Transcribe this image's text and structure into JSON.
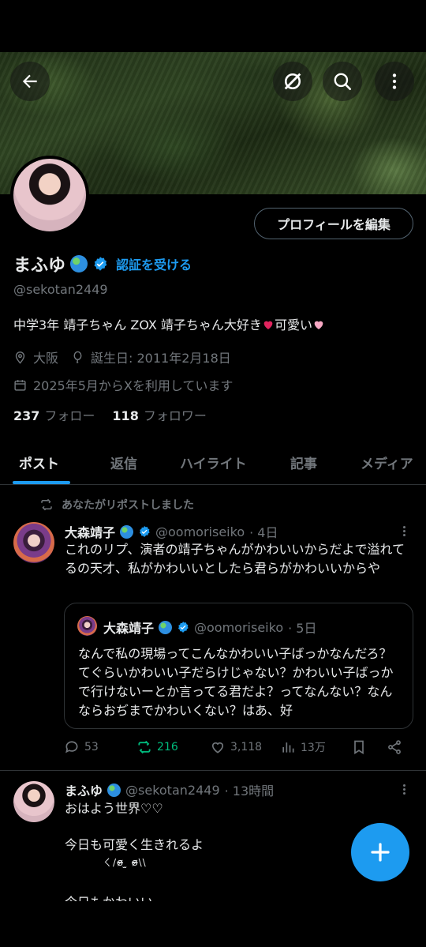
{
  "header": {
    "back_icon": "arrow-left-icon",
    "grok_icon": "grok-icon",
    "search_icon": "search-icon",
    "more_icon": "more-vertical-icon"
  },
  "profile": {
    "edit_button": "プロフィールを編集",
    "name": "まふゆ",
    "get_verified": "認証を受ける",
    "handle": "@sekotan2449",
    "bio": "中学3年 靖子ちゃん ZOX 靖子ちゃん大好き",
    "bio_tail": "可愛い",
    "location": "大阪",
    "birthday": "誕生日: 2011年2月18日",
    "joined": "2025年5月からXを利用しています",
    "following_count": "237",
    "following_label": "フォロー",
    "followers_count": "118",
    "followers_label": "フォロワー"
  },
  "tabs": [
    "ポスト",
    "返信",
    "ハイライト",
    "記事",
    "メディア"
  ],
  "timeline": {
    "repost_label": "あなたがリポストしました",
    "post1": {
      "name": "大森靖子",
      "handle": "@oomoriseiko",
      "time": "· 4日",
      "text": "これのリプ、演者の靖子ちゃんがかわいいからだよで溢れてるの天才、私がかわいいとしたら君らがかわいいからや",
      "quote": {
        "name": "大森靖子",
        "handle": "@oomoriseiko",
        "time": "· 5日",
        "text": "なんで私の現場ってこんなかわいい子ばっかなんだろ？てぐらいかわいい子だらけじゃない？かわいい子ばっかで行けないーとか言ってる君だよ？ってなんない？なんならおぢまでかわいくない？はあ、好"
      },
      "replies": "53",
      "reposts": "216",
      "likes": "3,118",
      "views": "13万"
    },
    "post2": {
      "name": "まふゆ",
      "handle": "@sekotan2449",
      "time": "· 13時間",
      "line1": "おはよう世界♡♡",
      "line2": "今日も可愛く生きれるよ",
      "kaomoji": "ㄑ/ɞ̴̶̷ ̫ ɞ̴̶̷\\\\",
      "line3": "今日もかわいい"
    }
  },
  "fab": {
    "icon": "plus-icon"
  },
  "colors": {
    "accent": "#1d9bf0",
    "repost_active": "#00ba7c",
    "muted": "#71767b",
    "background": "#000000"
  }
}
